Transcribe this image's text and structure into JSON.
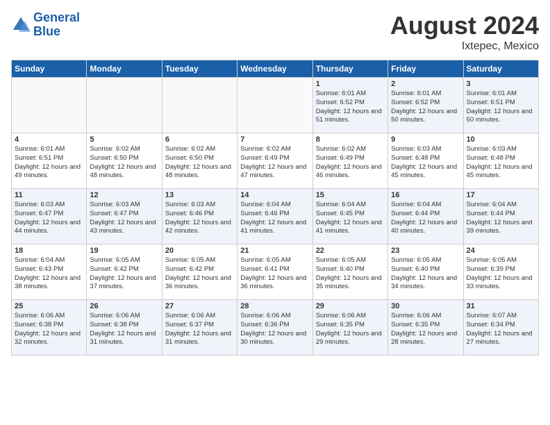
{
  "header": {
    "logo_line1": "General",
    "logo_line2": "Blue",
    "month_year": "August 2024",
    "location": "Ixtepec, Mexico"
  },
  "days_of_week": [
    "Sunday",
    "Monday",
    "Tuesday",
    "Wednesday",
    "Thursday",
    "Friday",
    "Saturday"
  ],
  "weeks": [
    [
      {
        "day": "",
        "sunrise": "",
        "sunset": "",
        "daylight": ""
      },
      {
        "day": "",
        "sunrise": "",
        "sunset": "",
        "daylight": ""
      },
      {
        "day": "",
        "sunrise": "",
        "sunset": "",
        "daylight": ""
      },
      {
        "day": "",
        "sunrise": "",
        "sunset": "",
        "daylight": ""
      },
      {
        "day": "1",
        "sunrise": "Sunrise: 6:01 AM",
        "sunset": "Sunset: 6:52 PM",
        "daylight": "Daylight: 12 hours and 51 minutes."
      },
      {
        "day": "2",
        "sunrise": "Sunrise: 6:01 AM",
        "sunset": "Sunset: 6:52 PM",
        "daylight": "Daylight: 12 hours and 50 minutes."
      },
      {
        "day": "3",
        "sunrise": "Sunrise: 6:01 AM",
        "sunset": "Sunset: 6:51 PM",
        "daylight": "Daylight: 12 hours and 50 minutes."
      }
    ],
    [
      {
        "day": "4",
        "sunrise": "Sunrise: 6:01 AM",
        "sunset": "Sunset: 6:51 PM",
        "daylight": "Daylight: 12 hours and 49 minutes."
      },
      {
        "day": "5",
        "sunrise": "Sunrise: 6:02 AM",
        "sunset": "Sunset: 6:50 PM",
        "daylight": "Daylight: 12 hours and 48 minutes."
      },
      {
        "day": "6",
        "sunrise": "Sunrise: 6:02 AM",
        "sunset": "Sunset: 6:50 PM",
        "daylight": "Daylight: 12 hours and 48 minutes."
      },
      {
        "day": "7",
        "sunrise": "Sunrise: 6:02 AM",
        "sunset": "Sunset: 6:49 PM",
        "daylight": "Daylight: 12 hours and 47 minutes."
      },
      {
        "day": "8",
        "sunrise": "Sunrise: 6:02 AM",
        "sunset": "Sunset: 6:49 PM",
        "daylight": "Daylight: 12 hours and 46 minutes."
      },
      {
        "day": "9",
        "sunrise": "Sunrise: 6:03 AM",
        "sunset": "Sunset: 6:48 PM",
        "daylight": "Daylight: 12 hours and 45 minutes."
      },
      {
        "day": "10",
        "sunrise": "Sunrise: 6:03 AM",
        "sunset": "Sunset: 6:48 PM",
        "daylight": "Daylight: 12 hours and 45 minutes."
      }
    ],
    [
      {
        "day": "11",
        "sunrise": "Sunrise: 6:03 AM",
        "sunset": "Sunset: 6:47 PM",
        "daylight": "Daylight: 12 hours and 44 minutes."
      },
      {
        "day": "12",
        "sunrise": "Sunrise: 6:03 AM",
        "sunset": "Sunset: 6:47 PM",
        "daylight": "Daylight: 12 hours and 43 minutes."
      },
      {
        "day": "13",
        "sunrise": "Sunrise: 6:03 AM",
        "sunset": "Sunset: 6:46 PM",
        "daylight": "Daylight: 12 hours and 42 minutes."
      },
      {
        "day": "14",
        "sunrise": "Sunrise: 6:04 AM",
        "sunset": "Sunset: 6:46 PM",
        "daylight": "Daylight: 12 hours and 41 minutes."
      },
      {
        "day": "15",
        "sunrise": "Sunrise: 6:04 AM",
        "sunset": "Sunset: 6:45 PM",
        "daylight": "Daylight: 12 hours and 41 minutes."
      },
      {
        "day": "16",
        "sunrise": "Sunrise: 6:04 AM",
        "sunset": "Sunset: 6:44 PM",
        "daylight": "Daylight: 12 hours and 40 minutes."
      },
      {
        "day": "17",
        "sunrise": "Sunrise: 6:04 AM",
        "sunset": "Sunset: 6:44 PM",
        "daylight": "Daylight: 12 hours and 39 minutes."
      }
    ],
    [
      {
        "day": "18",
        "sunrise": "Sunrise: 6:04 AM",
        "sunset": "Sunset: 6:43 PM",
        "daylight": "Daylight: 12 hours and 38 minutes."
      },
      {
        "day": "19",
        "sunrise": "Sunrise: 6:05 AM",
        "sunset": "Sunset: 6:42 PM",
        "daylight": "Daylight: 12 hours and 37 minutes."
      },
      {
        "day": "20",
        "sunrise": "Sunrise: 6:05 AM",
        "sunset": "Sunset: 6:42 PM",
        "daylight": "Daylight: 12 hours and 36 minutes."
      },
      {
        "day": "21",
        "sunrise": "Sunrise: 6:05 AM",
        "sunset": "Sunset: 6:41 PM",
        "daylight": "Daylight: 12 hours and 36 minutes."
      },
      {
        "day": "22",
        "sunrise": "Sunrise: 6:05 AM",
        "sunset": "Sunset: 6:40 PM",
        "daylight": "Daylight: 12 hours and 35 minutes."
      },
      {
        "day": "23",
        "sunrise": "Sunrise: 6:05 AM",
        "sunset": "Sunset: 6:40 PM",
        "daylight": "Daylight: 12 hours and 34 minutes."
      },
      {
        "day": "24",
        "sunrise": "Sunrise: 6:05 AM",
        "sunset": "Sunset: 6:39 PM",
        "daylight": "Daylight: 12 hours and 33 minutes."
      }
    ],
    [
      {
        "day": "25",
        "sunrise": "Sunrise: 6:06 AM",
        "sunset": "Sunset: 6:38 PM",
        "daylight": "Daylight: 12 hours and 32 minutes."
      },
      {
        "day": "26",
        "sunrise": "Sunrise: 6:06 AM",
        "sunset": "Sunset: 6:38 PM",
        "daylight": "Daylight: 12 hours and 31 minutes."
      },
      {
        "day": "27",
        "sunrise": "Sunrise: 6:06 AM",
        "sunset": "Sunset: 6:37 PM",
        "daylight": "Daylight: 12 hours and 31 minutes."
      },
      {
        "day": "28",
        "sunrise": "Sunrise: 6:06 AM",
        "sunset": "Sunset: 6:36 PM",
        "daylight": "Daylight: 12 hours and 30 minutes."
      },
      {
        "day": "29",
        "sunrise": "Sunrise: 6:06 AM",
        "sunset": "Sunset: 6:35 PM",
        "daylight": "Daylight: 12 hours and 29 minutes."
      },
      {
        "day": "30",
        "sunrise": "Sunrise: 6:06 AM",
        "sunset": "Sunset: 6:35 PM",
        "daylight": "Daylight: 12 hours and 28 minutes."
      },
      {
        "day": "31",
        "sunrise": "Sunrise: 6:07 AM",
        "sunset": "Sunset: 6:34 PM",
        "daylight": "Daylight: 12 hours and 27 minutes."
      }
    ]
  ]
}
